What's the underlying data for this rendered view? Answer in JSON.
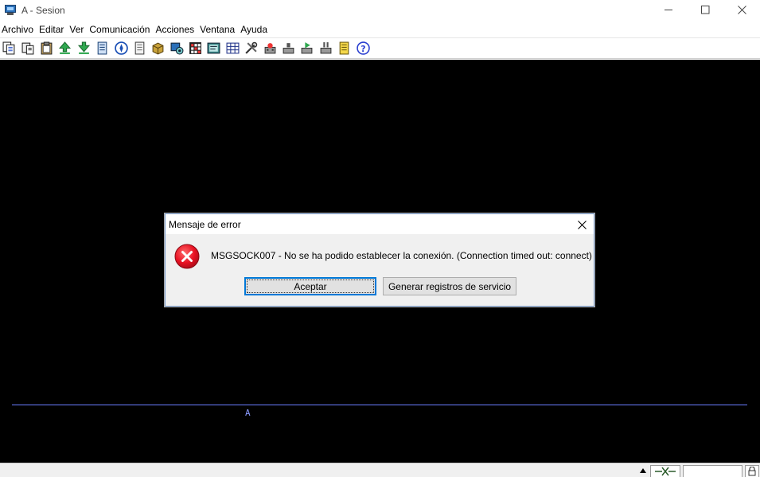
{
  "window": {
    "title": "A - Sesion",
    "controls": [
      "minimize-icon",
      "maximize-icon",
      "close-icon"
    ]
  },
  "menu": {
    "items": [
      "Archivo",
      "Editar",
      "Ver",
      "Comunicación",
      "Acciones",
      "Ventana",
      "Ayuda"
    ]
  },
  "toolbar": {
    "icons": [
      "copy-icon",
      "paste-icon",
      "clipboard-icon",
      "send-file-icon",
      "receive-file-icon",
      "document-icon",
      "compass-icon",
      "notebook-icon",
      "package-icon",
      "macro-icon",
      "keypad-icon",
      "screen-icon",
      "grid-icon",
      "wrench-icon",
      "record-icon",
      "stop-icon",
      "play-icon",
      "pause-icon",
      "notes-icon",
      "help-icon"
    ]
  },
  "terminal": {
    "status_indicator": "A"
  },
  "dialog": {
    "title": "Mensaje de error",
    "icon": "error-icon",
    "message": "MSGSOCK007 - No se ha podido establecer la conexión. (Connection timed out: connect)",
    "buttons": {
      "accept": "Aceptar",
      "service_logs": "Generar registros de servicio"
    }
  },
  "colors": {
    "terminal_bg": "#000000",
    "terminal_line": "#6a7dff",
    "accent": "#0078d7",
    "error": "#e81123"
  }
}
